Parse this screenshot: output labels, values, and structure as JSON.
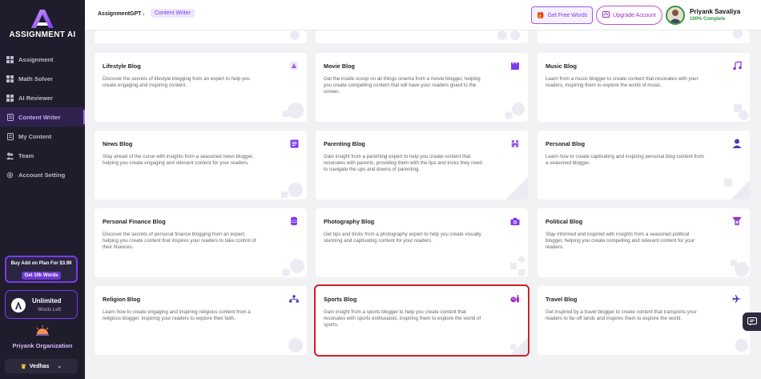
{
  "sidebar": {
    "brand": "ASSIGNMENT AI",
    "items": [
      {
        "label": "Assignment",
        "icon": "grid-icon"
      },
      {
        "label": "Math Solver",
        "icon": "grid-icon"
      },
      {
        "label": "AI Reviewer",
        "icon": "grid-icon"
      },
      {
        "label": "Content Writer",
        "icon": "document-icon",
        "active": true
      },
      {
        "label": "My Content",
        "icon": "document-icon"
      },
      {
        "label": "Team",
        "icon": "team-icon"
      },
      {
        "label": "Account Setting",
        "icon": "gear-icon"
      }
    ],
    "promo": {
      "title": "Buy Add on Plan For $3.99",
      "button": "Get 10k Words"
    },
    "credits": {
      "title": "Unlimited",
      "subtitle": "Words Left"
    },
    "organization": "Priyank Organization",
    "workspace": "Vedhas"
  },
  "topbar": {
    "breadcrumb": [
      "AssignmentGPT",
      "Content Writer"
    ],
    "free_words": "Get Free Words",
    "upgrade": "Upgrade Account",
    "user_name": "Priyank Savaliya",
    "user_status": "100% Complete"
  },
  "cards": [
    {
      "title": "Lifestyle Blog",
      "desc": "Discover the secrets of lifestyle blogging from an expert to help you create engaging and inspiring content.",
      "icon": "lifestyle-icon"
    },
    {
      "title": "Movie Blog",
      "desc": "Get the inside scoop on all things cinema from a movie blogger, helping you create compelling content that will have your readers glued to the screen.",
      "icon": "clapperboard-icon"
    },
    {
      "title": "Music Blog",
      "desc": "Learn from a music blogger to create content that resonates with your readers, inspiring them to explore the world of music.",
      "icon": "music-note-icon"
    },
    {
      "title": "News Blog",
      "desc": "Stay ahead of the curve with insights from a seasoned news blogger, helping you create engaging and relevant content for your readers.",
      "icon": "newspaper-icon"
    },
    {
      "title": "Parenting Blog",
      "desc": "Gain insight from a parenting expert to help you create content that resonates with parents, providing them with the tips and tricks they need to navigate the ups and downs of parenting.",
      "icon": "family-icon"
    },
    {
      "title": "Personal Blog",
      "desc": "Learn how to create captivating and inspiring personal blog content from a seasoned blogger.",
      "icon": "person-icon"
    },
    {
      "title": "Personal Finance Blog",
      "desc": "Discover the secrets of personal finance blogging from an expert, helping you create content that inspires your readers to take control of their finances.",
      "icon": "coins-icon"
    },
    {
      "title": "Photography Blog",
      "desc": "Get tips and tricks from a photography expert to help you create visually stunning and captivating content for your readers.",
      "icon": "camera-icon"
    },
    {
      "title": "Political Blog",
      "desc": "Stay informed and inspired with insights from a seasoned political blogger, helping you create compelling and relevant content for your readers.",
      "icon": "podium-icon"
    },
    {
      "title": "Religion Blog",
      "desc": "Learn how to create engaging and inspiring religious content from a religious blogger, inspiring your readers to explore their faith.",
      "icon": "hierarchy-icon"
    },
    {
      "title": "Sports Blog",
      "desc": "Gain insight from a sports blogger to help you create content that resonates with sports enthusiasts, inspiring them to explore the world of sports.",
      "icon": "sports-icon",
      "selected": true
    },
    {
      "title": "Travel Blog",
      "desc": "Get inspired by a travel blogger to create content that transports your readers to far-off lands and inspires them to explore the world.",
      "icon": "airplane-icon"
    }
  ],
  "colors": {
    "accent": "#7c3aed",
    "sidebar_bg": "#1f1d2b",
    "selected_outline": "#d01f2a"
  }
}
